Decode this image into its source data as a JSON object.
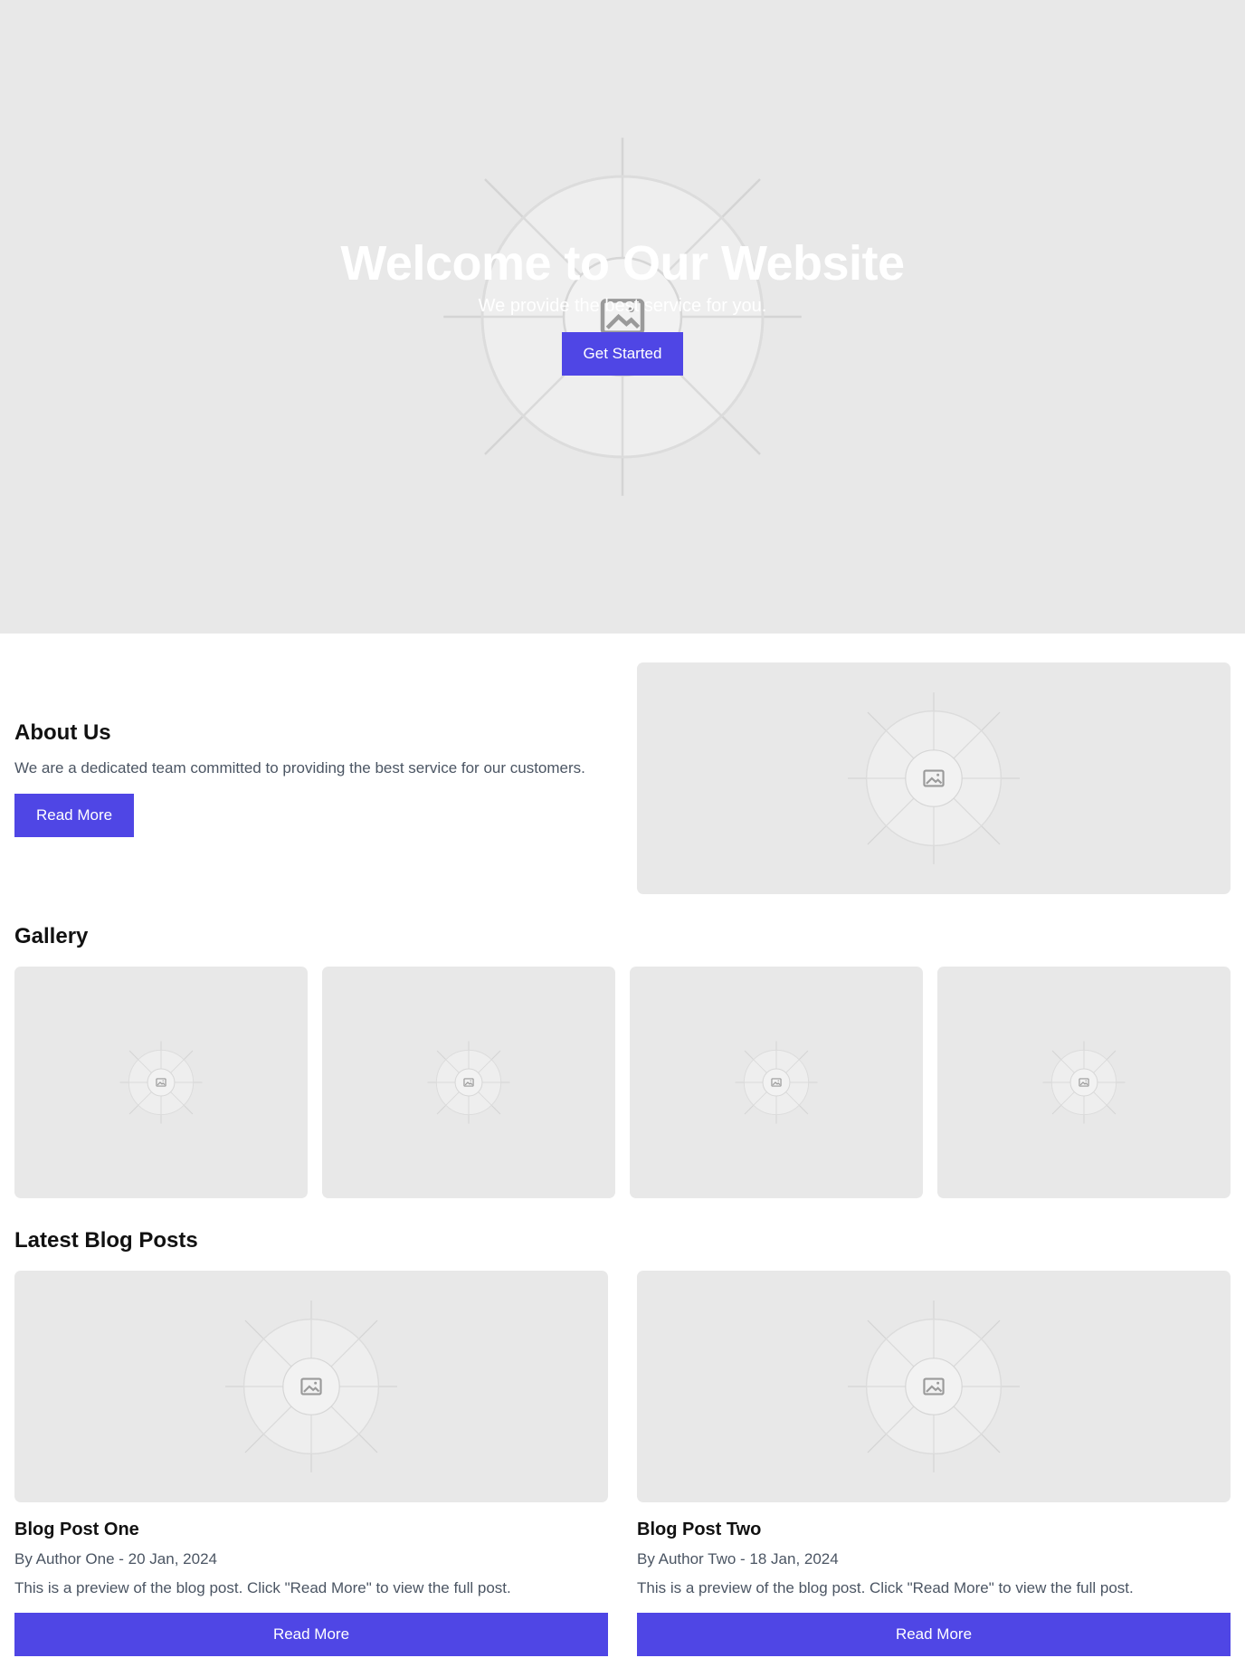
{
  "hero": {
    "title": "Welcome to Our Website",
    "subtitle": "We provide the best service for you.",
    "cta_label": "Get Started",
    "image_icon": "image-placeholder-icon"
  },
  "about": {
    "title": "About Us",
    "description": "We are a dedicated team committed to providing the best service for our customers.",
    "button_label": "Read More",
    "image_icon": "image-placeholder-icon"
  },
  "gallery": {
    "title": "Gallery",
    "images": [
      {
        "icon": "image-placeholder-icon"
      },
      {
        "icon": "image-placeholder-icon"
      },
      {
        "icon": "image-placeholder-icon"
      },
      {
        "icon": "image-placeholder-icon"
      }
    ]
  },
  "blog": {
    "title": "Latest Blog Posts",
    "posts": [
      {
        "title": "Blog Post One",
        "meta": "By Author One - 20 Jan, 2024",
        "preview": "This is a preview of the blog post. Click \"Read More\" to view the full post.",
        "button_label": "Read More"
      },
      {
        "title": "Blog Post Two",
        "meta": "By Author Two - 18 Jan, 2024",
        "preview": "This is a preview of the blog post. Click \"Read More\" to view the full post.",
        "button_label": "Read More"
      }
    ]
  },
  "colors": {
    "accent": "#4f46e5",
    "placeholder_bg": "#e8e8e8",
    "muted_text": "#4b5563",
    "heading_text": "#111111"
  }
}
